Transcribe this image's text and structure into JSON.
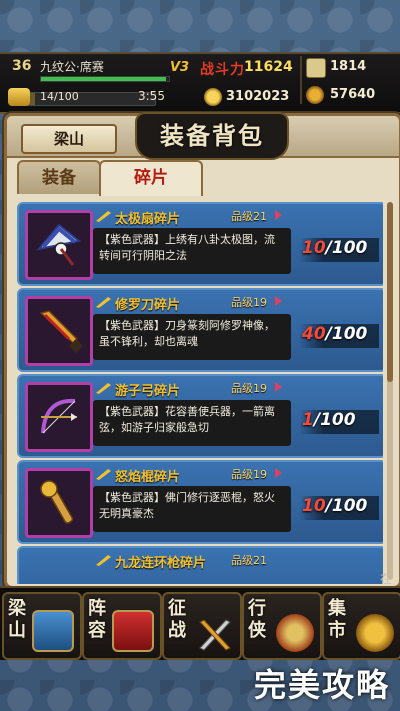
{
  "status": {
    "level": "36",
    "player_name": "九纹公·席赛",
    "exp_fraction": 0.98,
    "vip": "V3",
    "power_label": "战斗力",
    "power_value": "11624",
    "stamina": "14/100",
    "stamina_fraction": 0.14,
    "timer": "3:55",
    "gold": "3102023",
    "scroll_currency": "1814",
    "gourd_currency": "57640"
  },
  "panel": {
    "back_label": "梁山",
    "title": "装备背包",
    "tabs": [
      {
        "label": "装备",
        "active": false
      },
      {
        "label": "碎片",
        "active": true
      }
    ]
  },
  "fragments": [
    {
      "name": "太极扇碎片",
      "grade": "品级21",
      "desc": "【紫色武器】上绣有八卦太极图，流转间可行阴阳之法",
      "have": "10",
      "need": "100",
      "icon": "fan-icon"
    },
    {
      "name": "修罗刀碎片",
      "grade": "品级19",
      "desc": "【紫色武器】刀身篆刻阿修罗神像，虽不锋利，却也离魂",
      "have": "40",
      "need": "100",
      "icon": "blade-icon"
    },
    {
      "name": "游子弓碎片",
      "grade": "品级19",
      "desc": "【紫色武器】花容善使兵器，一箭离弦，如游子归家般急切",
      "have": "1",
      "need": "100",
      "icon": "bow-icon"
    },
    {
      "name": "怒焰棍碎片",
      "grade": "品级19",
      "desc": "【紫色武器】佛门修行逐恶棍，怒火无明真豪杰",
      "have": "10",
      "need": "100",
      "icon": "staff-icon"
    },
    {
      "name": "九龙连环枪碎片",
      "grade": "品级21",
      "desc": "",
      "have": "",
      "need": "",
      "icon": "spear-icon"
    }
  ],
  "nav": [
    {
      "label": "梁山",
      "icon": "mountain-gate-icon"
    },
    {
      "label": "阵容",
      "icon": "formation-icon"
    },
    {
      "label": "征战",
      "icon": "crossed-swords-icon"
    },
    {
      "label": "行侠",
      "icon": "shield-icon"
    },
    {
      "label": "集市",
      "icon": "market-icon"
    }
  ],
  "watermark": "完美攻略",
  "partial_text": "在",
  "colors": {
    "accent_red": "#b21c12",
    "gold": "#f4c030",
    "card_blue": "#3a72b0",
    "rarity_purple": "#b040a8"
  }
}
